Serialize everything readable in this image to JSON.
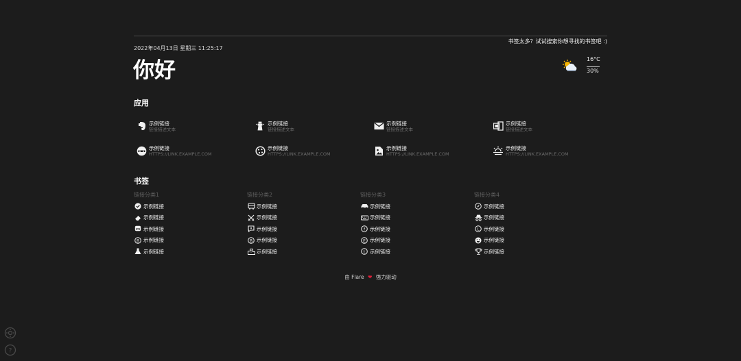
{
  "search": {
    "hint": "书签太多？试试搜索你想寻找的书签吧 :)"
  },
  "header": {
    "datetime": "2022年04月13日 星期三 11:25:17",
    "greeting": "你好"
  },
  "weather": {
    "icon": "partly-cloudy-icon",
    "temperature": "16°C",
    "humidity": "30%"
  },
  "apps": {
    "title": "应用",
    "items": [
      {
        "icon": "evernote-icon",
        "name": "示例链接",
        "desc": "链接描述文本"
      },
      {
        "icon": "lighthouse-icon",
        "name": "示例链接",
        "desc": "链接描述文本"
      },
      {
        "icon": "mail-icon",
        "name": "示例链接",
        "desc": "链接描述文本"
      },
      {
        "icon": "office-icon",
        "name": "示例链接",
        "desc": "链接描述文本"
      },
      {
        "icon": "mask-icon",
        "name": "示例链接",
        "desc": "HTTPS://LINK.EXAMPLE.COM"
      },
      {
        "icon": "cookie-icon",
        "name": "示例链接",
        "desc": "HTTPS://LINK.EXAMPLE.COM"
      },
      {
        "icon": "image-file-icon",
        "name": "示例链接",
        "desc": "HTTPS://LINK.EXAMPLE.COM"
      },
      {
        "icon": "sunset-icon",
        "name": "示例链接",
        "desc": "HTTPS://LINK.EXAMPLE.COM"
      }
    ]
  },
  "bookmarks": {
    "title": "书签",
    "categories": [
      {
        "name": "链接分类1",
        "items": [
          {
            "icon": "check-badge-icon",
            "label": "示例链接"
          },
          {
            "icon": "eraser-icon",
            "label": "示例链接"
          },
          {
            "icon": "mastodon-icon",
            "label": "示例链接"
          },
          {
            "icon": "bitcoin-icon",
            "label": "示例链接"
          },
          {
            "icon": "flask-icon",
            "label": "示例链接"
          }
        ]
      },
      {
        "name": "链接分类2",
        "items": [
          {
            "icon": "bus-icon",
            "label": "示例链接"
          },
          {
            "icon": "swords-icon",
            "label": "示例链接"
          },
          {
            "icon": "comment-icon",
            "label": "示例链接"
          },
          {
            "icon": "bitcoin-icon",
            "label": "示例链接"
          },
          {
            "icon": "city-icon",
            "label": "示例链接"
          }
        ]
      },
      {
        "name": "链接分类3",
        "items": [
          {
            "icon": "car-icon",
            "label": "示例链接"
          },
          {
            "icon": "keyboard-icon",
            "label": "示例链接"
          },
          {
            "icon": "facebook-icon",
            "label": "示例链接"
          },
          {
            "icon": "ethereum-icon",
            "label": "示例链接"
          },
          {
            "icon": "tumblr-icon",
            "label": "示例链接"
          }
        ]
      },
      {
        "name": "链接分类4",
        "items": [
          {
            "icon": "compass-icon",
            "label": "示例链接"
          },
          {
            "icon": "incognito-icon",
            "label": "示例链接"
          },
          {
            "icon": "litecoin-icon",
            "label": "示例链接"
          },
          {
            "icon": "smile-icon",
            "label": "示例链接"
          },
          {
            "icon": "trophy-icon",
            "label": "示例链接"
          }
        ]
      }
    ]
  },
  "footer": {
    "prefix": "由 Flare",
    "heart": "❤",
    "suffix": "强力驱动"
  },
  "corner": {
    "settings_icon": "gear-icon",
    "help_icon": "help-icon"
  },
  "colors": {
    "background": "#1c1c1c",
    "heart": "#e0203a",
    "muted": "#6c6c6c"
  }
}
